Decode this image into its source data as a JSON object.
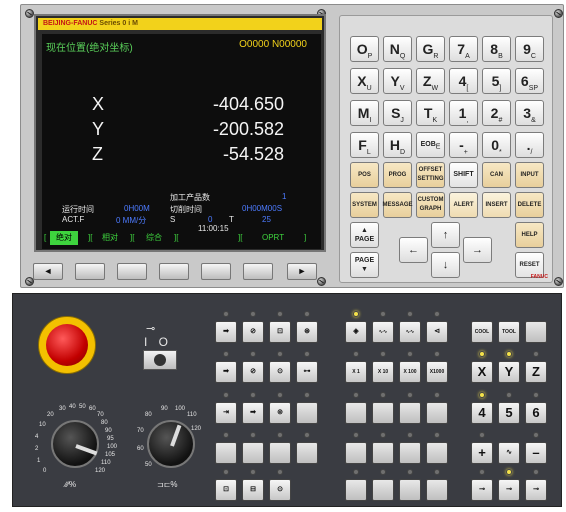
{
  "brand": {
    "prefix": "BEIJING-FANUC",
    "series": "Series 0",
    "model": "i M"
  },
  "screen": {
    "title": "现在位置(绝对坐标)",
    "program": "O0000 N00000",
    "axes": [
      {
        "label": "X",
        "value": "-404.650"
      },
      {
        "label": "Y",
        "value": "-200.582"
      },
      {
        "label": "Z",
        "value": "-54.528"
      }
    ],
    "parts_count_label": "加工产品数",
    "parts_count": "1",
    "run_time_label": "运行时间",
    "run_time": "0H00M",
    "cycle_time_label": "切削时间",
    "cycle_time": "0H00M00S",
    "actf_label": "ACT.F",
    "actf_value": "0 MM/分",
    "s_label": "S",
    "s_value": "0",
    "t_label": "T",
    "t_value": "25",
    "clock": "11:00:15",
    "softkeys": [
      "绝对",
      "相对",
      "综合",
      "",
      "OPRT"
    ]
  },
  "monitor_buttons": [
    "◄",
    "",
    "",
    "",
    "",
    "",
    "►"
  ],
  "keypad": {
    "alpha": [
      [
        "O",
        "P"
      ],
      [
        "N",
        "Q"
      ],
      [
        "G",
        "R"
      ],
      [
        "7",
        "A"
      ],
      [
        "8",
        "B"
      ],
      [
        "9",
        "C"
      ],
      [
        "X",
        "U"
      ],
      [
        "Y",
        "V"
      ],
      [
        "Z",
        "W"
      ],
      [
        "4",
        "["
      ],
      [
        "5",
        "]"
      ],
      [
        "6",
        "SP"
      ],
      [
        "M",
        "I"
      ],
      [
        "S",
        "J"
      ],
      [
        "T",
        "K"
      ],
      [
        "1",
        ","
      ],
      [
        "2",
        "#"
      ],
      [
        "3",
        "&"
      ],
      [
        "F",
        "L"
      ],
      [
        "H",
        "D"
      ],
      [
        "EOB",
        "E"
      ],
      [
        "-",
        "+"
      ],
      [
        "0",
        "*"
      ],
      [
        ".",
        "/"
      ]
    ],
    "func_row1": [
      "POS",
      "PROG",
      "OFFSET SETTING",
      "SHIFT",
      "CAN",
      "INPUT"
    ],
    "func_row2": [
      "SYSTEM",
      "MESSAGE",
      "CUSTOM GRAPH",
      "ALERT",
      "INSERT",
      "DELETE"
    ],
    "page_up": "PAGE",
    "page_down": "PAGE",
    "help": "HELP",
    "reset": "RESET",
    "logo": "FANUC"
  },
  "operator_panel": {
    "keyswitch_icon": "⊸",
    "keyswitch_label": "I O",
    "feed_scale": [
      "20",
      "30",
      "40",
      "50",
      "60",
      "70",
      "80",
      "90",
      "95",
      "100",
      "105",
      "110",
      "120",
      "10",
      "4",
      "2",
      "1",
      "0"
    ],
    "feed_label": "∕∕∕%",
    "spindle_scale": [
      "90",
      "100",
      "110",
      "120",
      "80",
      "70",
      "60",
      "50"
    ],
    "spindle_label": "%",
    "axis_buttons": [
      "X",
      "Y",
      "Z"
    ],
    "jog_buttons": [
      "4",
      "5",
      "6"
    ],
    "plus": "+",
    "minus": "–",
    "cool": "COOL",
    "tool": "TOOL",
    "handwheel": [
      "X 1",
      "X 10",
      "X 100",
      "X1000"
    ]
  }
}
